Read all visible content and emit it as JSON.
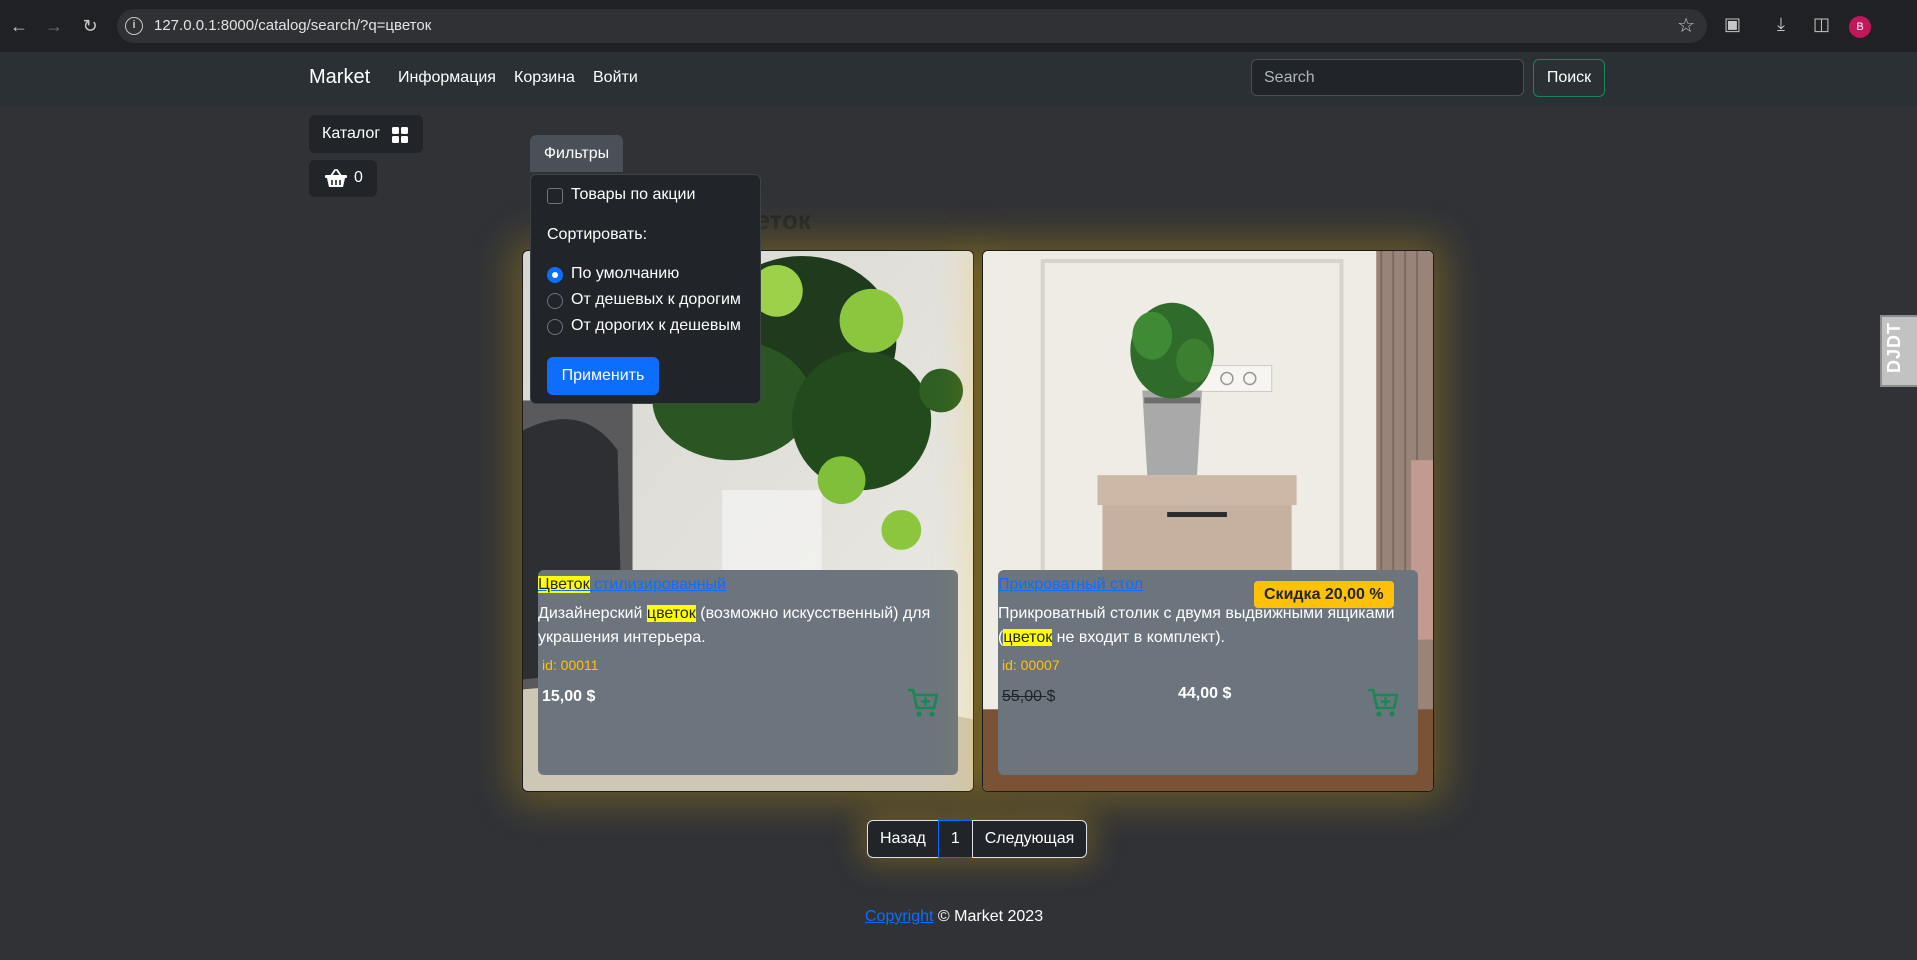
{
  "browser": {
    "url": "127.0.0.1:8000/catalog/search/?q=цветок",
    "profile_initial": "B"
  },
  "navbar": {
    "brand": "Market",
    "links": [
      "Информация",
      "Корзина",
      "Войти"
    ],
    "search_placeholder": "Search",
    "search_button": "Поиск"
  },
  "sidebar": {
    "catalog_label": "Каталог",
    "cart_count": "0"
  },
  "filters": {
    "button_label": "Фильтры",
    "on_sale_label": "Товары по акции",
    "on_sale_checked": false,
    "sort_label": "Сортировать:",
    "sort_options": [
      "По умолчанию",
      "От дешевых к дорогим",
      "От дорогих к дешевым"
    ],
    "sort_selected": "По умолчанию",
    "apply_label": "Применить"
  },
  "results_title": "ка по запросу цветок",
  "products": [
    {
      "name_highlight": "Цветок",
      "name_rest": " стилизированный",
      "desc_1": "Дизайнерский ",
      "desc_hl": "цветок",
      "desc_2": " (возможно искусственный) для украшения интерьера.",
      "id": "id: 00011",
      "price": "15,00 $"
    },
    {
      "name": "Прикроватный стол",
      "discount": "Скидка 20,00 %",
      "desc_1": "Прикроватный столик с двумя выдвижными ящиками (",
      "desc_hl": "цветок",
      "desc_2": " не входит в комплект).",
      "id": "id: 00007",
      "old_price": "55,00",
      "old_price_currency": "$",
      "price": "44,00 $"
    }
  ],
  "pagination": {
    "prev": "Назад",
    "current": "1",
    "next": "Следующая"
  },
  "footer": {
    "link": "Copyright",
    "text": " © Market 2023"
  },
  "debug_toolbar": "DJDT",
  "colors": {
    "primary": "#0d6efd",
    "success": "#198754",
    "warning": "#ffc107",
    "highlight": "#ffff00"
  }
}
